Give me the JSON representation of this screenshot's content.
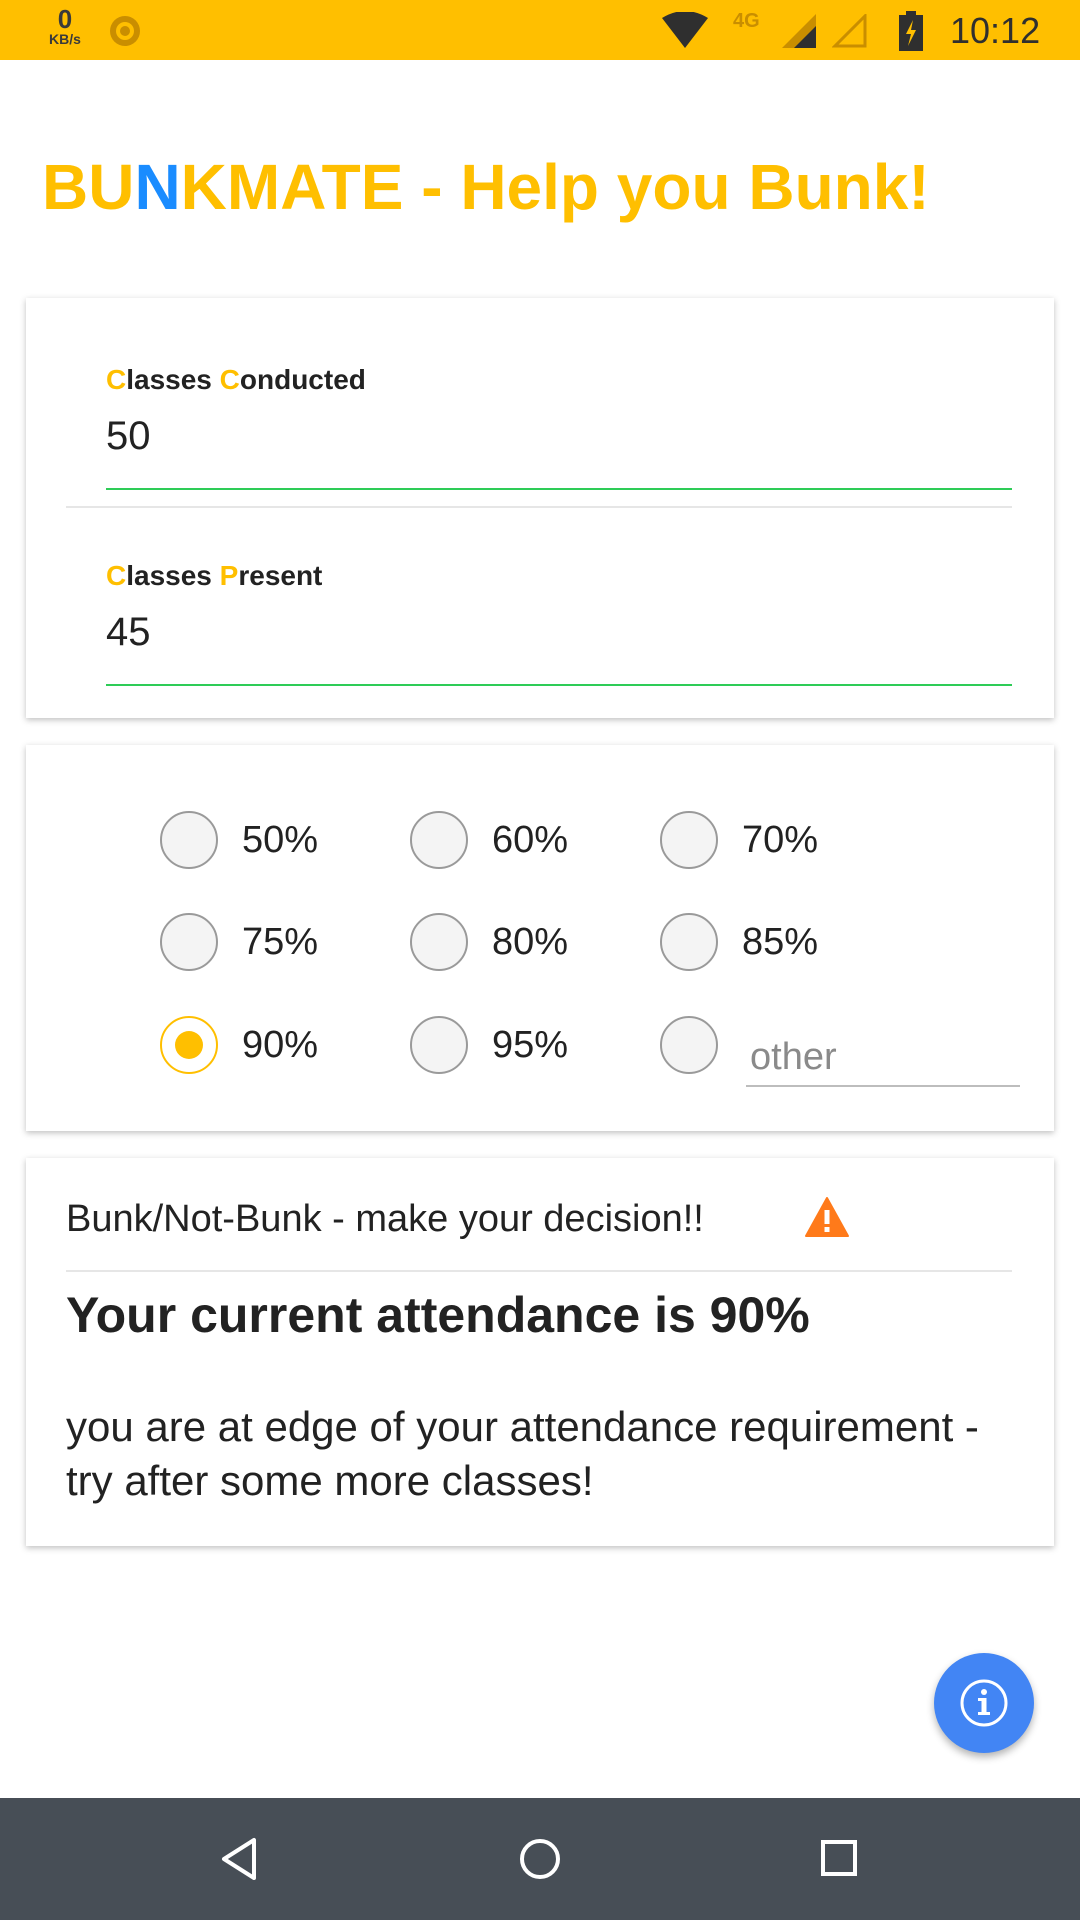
{
  "status_bar": {
    "data_rate": "0",
    "data_unit": "KB/s",
    "network_type": "4G",
    "time": "10:12"
  },
  "app": {
    "title_parts": [
      "BU",
      "N",
      "KMATE - Help you Bunk!"
    ]
  },
  "inputs": {
    "conducted": {
      "label_initial_1": "C",
      "label_rest_1": "lasses ",
      "label_initial_2": "C",
      "label_rest_2": "onducted",
      "value": "50"
    },
    "present": {
      "label_initial_1": "C",
      "label_rest_1": "lasses ",
      "label_initial_2": "P",
      "label_rest_2": "resent",
      "value": "45"
    }
  },
  "requirement": {
    "options": [
      "50%",
      "60%",
      "70%",
      "75%",
      "80%",
      "85%",
      "90%",
      "95%"
    ],
    "selected": "90%",
    "other_placeholder": "other"
  },
  "result": {
    "header": "Bunk/Not-Bunk - make your decision!!",
    "title": "Your current attendance is 90%",
    "message": "you are at edge of your attendance requirement - try after some more classes!"
  },
  "colors": {
    "accent": "#ffbf00",
    "title_highlight": "#1a8cff",
    "input_underline": "#2ecc57",
    "warning": "#ff7a1a",
    "fab": "#4285f4",
    "nav_bar": "#474e56"
  },
  "icons": {
    "status": [
      "sun-icon",
      "wifi-icon",
      "signal-icon",
      "signal-empty-icon",
      "battery-charging-icon"
    ],
    "result": "warning-icon",
    "fab": "info-icon",
    "nav": [
      "back-icon",
      "home-icon",
      "recents-icon"
    ]
  }
}
